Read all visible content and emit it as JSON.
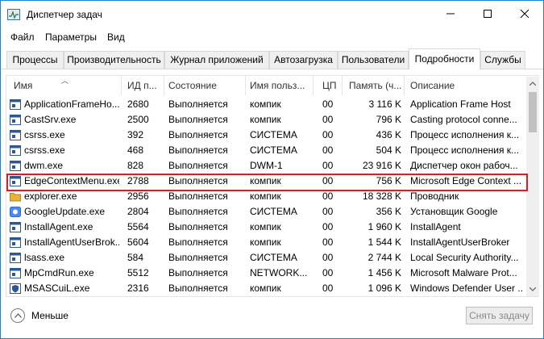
{
  "window": {
    "title": "Диспетчер задач",
    "accent": "#1883d7",
    "highlight_color": "#e01b24"
  },
  "menu": [
    "Файл",
    "Параметры",
    "Вид"
  ],
  "tabs": [
    {
      "label": "Процессы",
      "active": false
    },
    {
      "label": "Производительность",
      "active": false
    },
    {
      "label": "Журнал приложений",
      "active": false
    },
    {
      "label": "Автозагрузка",
      "active": false
    },
    {
      "label": "Пользователи",
      "active": false
    },
    {
      "label": "Подробности",
      "active": true
    },
    {
      "label": "Службы",
      "active": false
    }
  ],
  "columns": [
    "Имя",
    "ИД п...",
    "Состояние",
    "Имя польз...",
    "ЦП",
    "Память (ч...",
    "Описание"
  ],
  "rows": [
    {
      "name": "ApplicationFrameHo...",
      "pid": "2680",
      "status": "Выполняется",
      "user": "компик",
      "cpu": "00",
      "memory": "3 116 K",
      "desc": "Application Frame Host",
      "icon": "window-icon"
    },
    {
      "name": "CastSrv.exe",
      "pid": "2500",
      "status": "Выполняется",
      "user": "компик",
      "cpu": "00",
      "memory": "796 K",
      "desc": "Casting protocol conne...",
      "icon": "window-icon"
    },
    {
      "name": "csrss.exe",
      "pid": "392",
      "status": "Выполняется",
      "user": "СИСТЕМА",
      "cpu": "00",
      "memory": "436 K",
      "desc": "Процесс исполнения к...",
      "icon": "window-icon"
    },
    {
      "name": "csrss.exe",
      "pid": "468",
      "status": "Выполняется",
      "user": "СИСТЕМА",
      "cpu": "00",
      "memory": "504 K",
      "desc": "Процесс исполнения к...",
      "icon": "window-icon"
    },
    {
      "name": "dwm.exe",
      "pid": "828",
      "status": "Выполняется",
      "user": "DWM-1",
      "cpu": "00",
      "memory": "23 916 K",
      "desc": "Диспетчер окон рабоч...",
      "icon": "window-icon"
    },
    {
      "name": "EdgeContextMenu.exe",
      "pid": "2788",
      "status": "Выполняется",
      "user": "компик",
      "cpu": "00",
      "memory": "756 K",
      "desc": "Microsoft Edge Context ...",
      "icon": "window-icon"
    },
    {
      "name": "explorer.exe",
      "pid": "2956",
      "status": "Выполняется",
      "user": "компик",
      "cpu": "00",
      "memory": "18 328 K",
      "desc": "Проводник",
      "icon": "folder-icon"
    },
    {
      "name": "GoogleUpdate.exe",
      "pid": "2804",
      "status": "Выполняется",
      "user": "СИСТЕМА",
      "cpu": "00",
      "memory": "356 K",
      "desc": "Установщик Google",
      "icon": "google-update-icon"
    },
    {
      "name": "InstallAgent.exe",
      "pid": "5564",
      "status": "Выполняется",
      "user": "компик",
      "cpu": "00",
      "memory": "1 960 K",
      "desc": "InstallAgent",
      "icon": "window-icon"
    },
    {
      "name": "InstallAgentUserBrok...",
      "pid": "5604",
      "status": "Выполняется",
      "user": "компик",
      "cpu": "00",
      "memory": "1 544 K",
      "desc": "InstallAgentUserBroker",
      "icon": "window-icon"
    },
    {
      "name": "lsass.exe",
      "pid": "584",
      "status": "Выполняется",
      "user": "СИСТЕМА",
      "cpu": "00",
      "memory": "2 744 K",
      "desc": "Local Security Authority...",
      "icon": "window-icon"
    },
    {
      "name": "MpCmdRun.exe",
      "pid": "5512",
      "status": "Выполняется",
      "user": "NETWORK...",
      "cpu": "00",
      "memory": "1 456 K",
      "desc": "Microsoft Malware Prot...",
      "icon": "window-icon"
    },
    {
      "name": "MSASCuiL.exe",
      "pid": "2316",
      "status": "Выполняется",
      "user": "компик",
      "cpu": "00",
      "memory": "1 096 K",
      "desc": "Windows Defender User ...",
      "icon": "shield-icon"
    }
  ],
  "footer": {
    "less_label": "Меньше",
    "end_task_label": "Снять задачу"
  }
}
